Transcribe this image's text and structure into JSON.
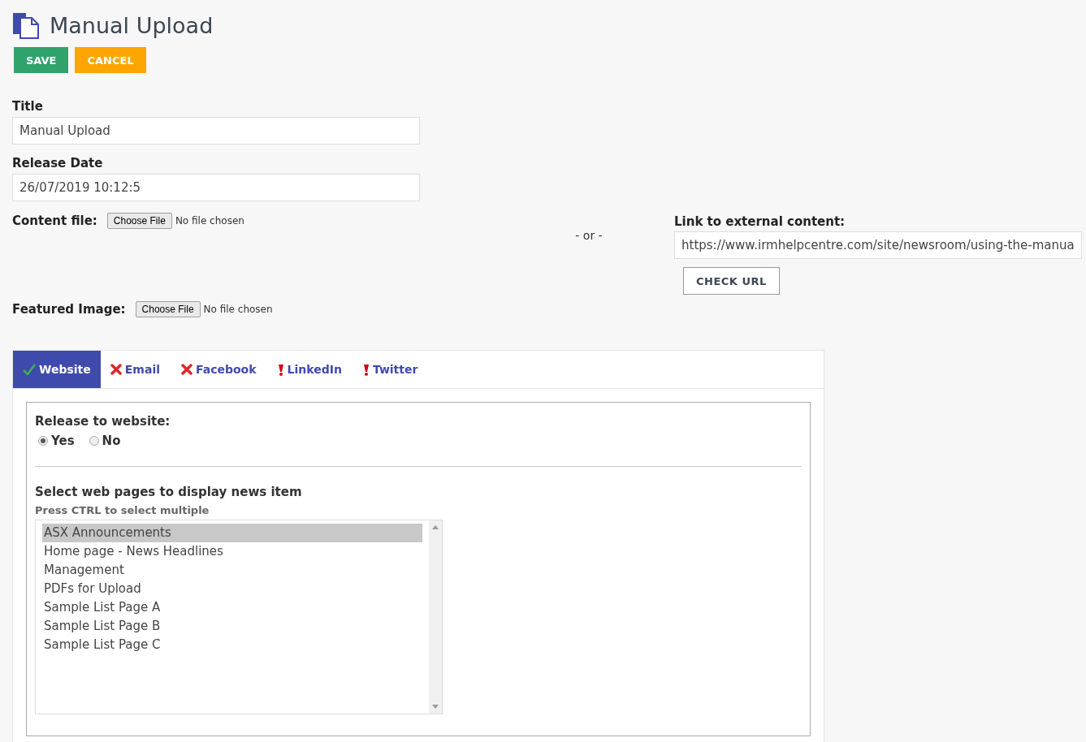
{
  "page": {
    "title": "Manual Upload"
  },
  "actions": [
    {
      "label": "SAVE",
      "kind": "primary"
    },
    {
      "label": "CANCEL",
      "kind": "warning"
    }
  ],
  "title_field": {
    "label": "Title",
    "value": "Manual Upload"
  },
  "release_date": {
    "label": "Release Date",
    "value": "26/07/2019 10:12:5"
  },
  "content_file": {
    "label": "Content file:",
    "button": "Choose File",
    "status": "No file chosen"
  },
  "separator": "- or -",
  "external_link": {
    "label": "Link to external content:",
    "value": "https://www.irmhelpcentre.com/site/newsroom/using-the-manua",
    "button": "CHECK URL"
  },
  "featured_image": {
    "label": "Featured Image:",
    "button": "Choose File",
    "status": "No file chosen"
  },
  "tabs": [
    {
      "label": "Website",
      "selected": true,
      "kind": "ok"
    },
    {
      "label": "Email",
      "selected": false,
      "kind": "error"
    },
    {
      "label": "Facebook",
      "selected": false,
      "kind": "error"
    },
    {
      "label": "LinkedIn",
      "selected": false,
      "kind": "warning"
    },
    {
      "label": "Twitter",
      "selected": false,
      "kind": "warning"
    }
  ],
  "website": {
    "release_label": "Release to website:",
    "options": [
      {
        "label": "Yes",
        "selected": true
      },
      {
        "label": "No",
        "selected": false
      }
    ],
    "pages_heading": "Select web pages to display news item",
    "pages_hint": "Press CTRL to select multiple",
    "pages": [
      {
        "label": "ASX Announcements",
        "selected": true
      },
      {
        "label": "Home page - News Headlines",
        "selected": false
      },
      {
        "label": "Management",
        "selected": false
      },
      {
        "label": "PDFs for Upload",
        "selected": false
      },
      {
        "label": "Sample List Page A",
        "selected": false
      },
      {
        "label": "Sample List Page B",
        "selected": false
      },
      {
        "label": "Sample List Page C",
        "selected": false
      }
    ]
  }
}
